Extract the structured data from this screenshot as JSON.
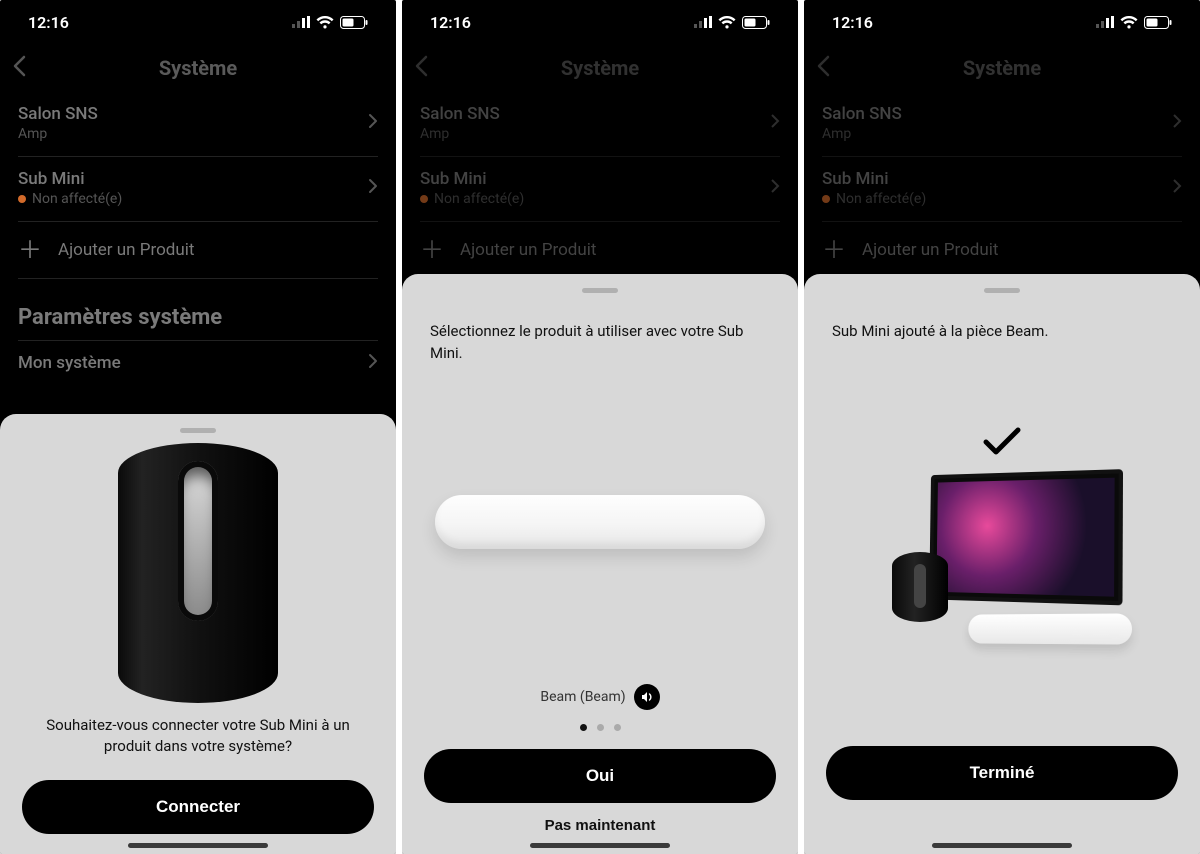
{
  "status": {
    "time": "12:16"
  },
  "nav": {
    "title": "Système"
  },
  "rows": {
    "room": {
      "title": "Salon SNS",
      "sub": "Amp"
    },
    "sub": {
      "title": "Sub Mini",
      "sub": "Non affecté(e)"
    },
    "add": "Ajouter un Produit"
  },
  "section": {
    "title": "Paramètres système",
    "item1": "Mon système"
  },
  "sheet1": {
    "text": "Souhaitez-vous connecter votre Sub Mini à un produit dans votre système?",
    "primary": "Connecter"
  },
  "sheet2": {
    "text": "Sélectionnez le produit à utiliser avec votre Sub Mini.",
    "product_label": "Beam (Beam)",
    "primary": "Oui",
    "secondary": "Pas maintenant"
  },
  "sheet3": {
    "text": "Sub Mini ajouté à la pièce Beam.",
    "primary": "Terminé"
  }
}
